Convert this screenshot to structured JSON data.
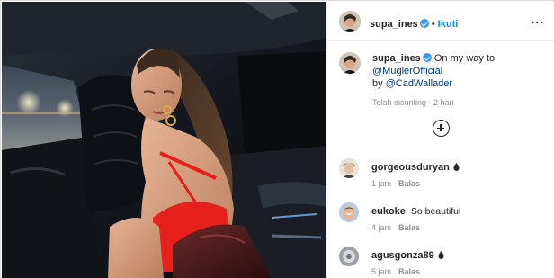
{
  "post": {
    "username": "supa_ines",
    "verified": true,
    "separator": "•",
    "follow_label": "Ikuti",
    "more_label": "...",
    "caption": {
      "author": "supa_ines",
      "text": "On my way to",
      "mention_1": "@MuglerOfficial",
      "by_text": "by",
      "mention_2": "@CadWallader"
    },
    "caption_meta": "Telah disunting · 2 hari",
    "load_more_icon": "plus-circle-icon"
  },
  "comments": [
    {
      "username": "gorgeousduryan",
      "text": "",
      "icon": "drop-icon",
      "time": "1 jam",
      "reply_label": "Balas"
    },
    {
      "username": "eukoke",
      "text": "So beautiful",
      "icon": "",
      "time": "4 jam",
      "reply_label": "Balas"
    },
    {
      "username": "agusgonza89",
      "text": "",
      "icon": "drop-icon",
      "time": "5 jam",
      "reply_label": "Balas"
    }
  ],
  "colors": {
    "link_blue": "#0095f6",
    "mention_blue": "#00376b",
    "verified_blue": "#3897f0",
    "muted_text": "#8e8e8e",
    "border": "#dbdbdb",
    "dress_red": "#e8201c"
  }
}
